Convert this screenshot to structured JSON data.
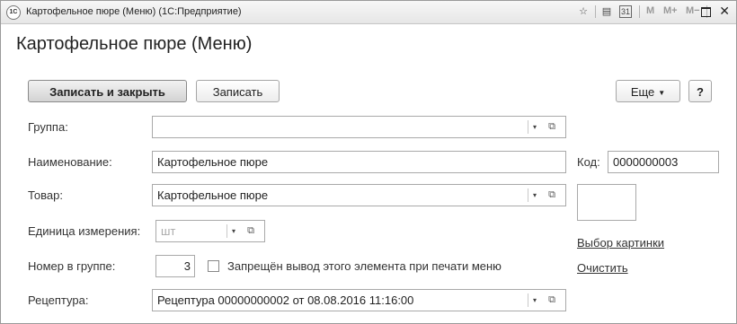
{
  "window": {
    "title": "Картофельное пюре (Меню)  (1С:Предприятие)",
    "logo_text": "1С",
    "toolbar": {
      "favorite_icon": "☆",
      "calc_icon": "▤",
      "calendar_icon": "31",
      "m_label": "M",
      "m_plus_label": "M+",
      "m_minus_label": "M−",
      "close_label": "✕"
    }
  },
  "form": {
    "title": "Картофельное пюре (Меню)",
    "buttons": {
      "save_close": "Записать и закрыть",
      "save": "Записать",
      "more": "Еще",
      "help": "?"
    },
    "fields": {
      "group": {
        "label": "Группа:",
        "value": ""
      },
      "name": {
        "label": "Наименование:",
        "value": "Картофельное пюре"
      },
      "code": {
        "label": "Код:",
        "value": "0000000003"
      },
      "product": {
        "label": "Товар:",
        "value": "Картофельное пюре"
      },
      "unit": {
        "label": "Единица измерения:",
        "value": "шт"
      },
      "number_in_group": {
        "label": "Номер в группе:",
        "value": "3"
      },
      "no_print": {
        "label": "Запрещён вывод этого элемента при печати меню",
        "checked": false
      },
      "recipe": {
        "label": "Рецептура:",
        "value": "Рецептура 00000000002 от 08.08.2016 11:16:00"
      }
    },
    "links": {
      "choose_picture": "Выбор картинки",
      "clear": "Очистить"
    },
    "icons": {
      "dropdown": "▾",
      "open": "⧉"
    }
  }
}
